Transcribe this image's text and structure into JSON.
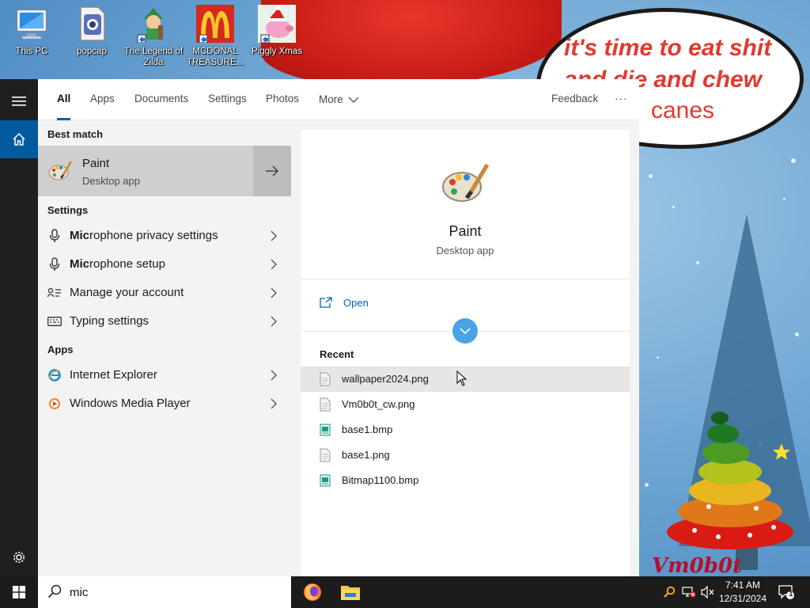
{
  "desktop": {
    "icons": [
      {
        "name": "this-pc",
        "label": "This PC"
      },
      {
        "name": "popcap",
        "label": "popcap"
      },
      {
        "name": "legend-of-zilda",
        "label": "The Legend of Zilda"
      },
      {
        "name": "mcdonald-treasure",
        "label": "MCDONAL TREASURE..."
      },
      {
        "name": "piggly-xmas",
        "label": "Piggly Xmas"
      }
    ],
    "wallpaper_text": {
      "line1": "it's time to eat shit",
      "line2": "and die and chew",
      "line3": "canes",
      "watermark": "Vm0b0t"
    }
  },
  "tabs": [
    {
      "label": "All",
      "active": true
    },
    {
      "label": "Apps"
    },
    {
      "label": "Documents"
    },
    {
      "label": "Settings"
    },
    {
      "label": "Photos"
    },
    {
      "label": "More"
    }
  ],
  "feedback_label": "Feedback",
  "more_options_label": "···",
  "results": {
    "best_match_header": "Best match",
    "best_match": {
      "title": "Paint",
      "subtitle": "Desktop app"
    },
    "settings_header": "Settings",
    "settings_items": [
      {
        "bold": "Mic",
        "rest": "rophone privacy settings",
        "icon": "microphone-icon"
      },
      {
        "bold": "Mic",
        "rest": "rophone setup",
        "icon": "microphone-icon"
      },
      {
        "bold": "",
        "rest": "Manage your account",
        "icon": "account-icon"
      },
      {
        "bold": "",
        "rest": "Typing settings",
        "icon": "keyboard-icon"
      }
    ],
    "apps_header": "Apps",
    "apps_items": [
      {
        "label": "Internet Explorer",
        "icon": "internet-explorer-icon"
      },
      {
        "label": "Windows Media Player",
        "icon": "media-player-icon"
      }
    ]
  },
  "preview": {
    "title": "Paint",
    "subtitle": "Desktop app",
    "open_label": "Open",
    "recent_header": "Recent",
    "recent_files": [
      {
        "name": "wallpaper2024.png",
        "type": "png"
      },
      {
        "name": "Vm0b0t_cw.png",
        "type": "png"
      },
      {
        "name": "base1.bmp",
        "type": "bmp"
      },
      {
        "name": "base1.png",
        "type": "png"
      },
      {
        "name": "Bitmap1100.bmp",
        "type": "bmp"
      }
    ]
  },
  "taskbar": {
    "search_value": "mic",
    "time": "7:41 AM",
    "date": "12/31/2024",
    "notification_count": "1"
  }
}
